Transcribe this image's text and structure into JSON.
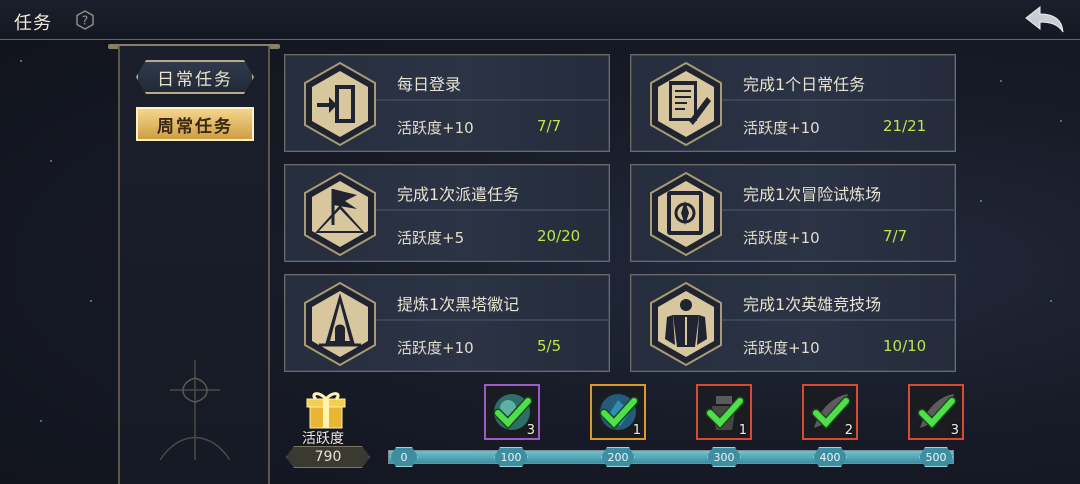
{
  "header": {
    "title": "任务",
    "help_icon": "question-icon",
    "back_icon": "back-arrow-icon"
  },
  "tabs": [
    {
      "label": "日常任务",
      "active": false
    },
    {
      "label": "周常任务",
      "active": true
    }
  ],
  "tasks": [
    {
      "name": "每日登录",
      "reward": "活跃度+10",
      "progress": "7/7",
      "icon": "door-enter-icon"
    },
    {
      "name": "完成1个日常任务",
      "reward": "活跃度+10",
      "progress": "21/21",
      "icon": "quest-scroll-icon"
    },
    {
      "name": "完成1次派遣任务",
      "reward": "活跃度+5",
      "progress": "20/20",
      "icon": "tent-flag-icon"
    },
    {
      "name": "完成1次冒险试炼场",
      "reward": "活跃度+10",
      "progress": "7/7",
      "icon": "trial-book-icon"
    },
    {
      "name": "提炼1次黑塔徽记",
      "reward": "活跃度+10",
      "progress": "5/5",
      "icon": "black-tower-icon"
    },
    {
      "name": "完成1次英雄竞技场",
      "reward": "活跃度+10",
      "progress": "10/10",
      "icon": "arena-warrior-icon"
    }
  ],
  "activity": {
    "label": "活跃度",
    "value": "790",
    "icon": "gift-box-icon"
  },
  "milestones": {
    "ticks": [
      "0",
      "100",
      "200",
      "300",
      "400",
      "500"
    ],
    "fill_fraction": 1.0,
    "rewards": [
      {
        "count": "3",
        "frame_color": "#9b5cc7",
        "item": "teal-orb-icon",
        "claimed": true
      },
      {
        "count": "1",
        "frame_color": "#d99a2b",
        "item": "blue-gem-icon",
        "claimed": true
      },
      {
        "count": "1",
        "frame_color": "#d84a32",
        "item": "potion-icon",
        "claimed": true
      },
      {
        "count": "2",
        "frame_color": "#d84a32",
        "item": "feather-icon",
        "claimed": true
      },
      {
        "count": "3",
        "frame_color": "#d84a32",
        "item": "feather-icon",
        "claimed": true
      }
    ]
  },
  "colors": {
    "accent_gold": "#d4b46a",
    "progress_green": "#b9e84a",
    "check_green": "#4ee04a"
  }
}
